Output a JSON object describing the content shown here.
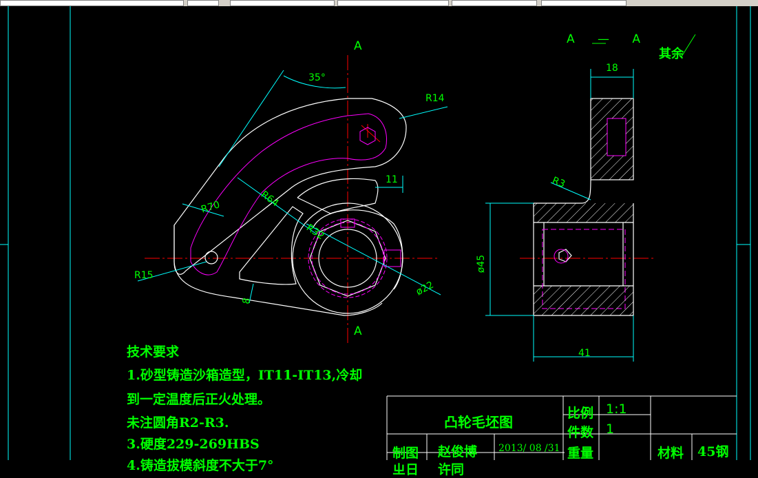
{
  "drawing": {
    "section_label_top": "A",
    "section_label_bottom": "A",
    "section_view_title": "A — A",
    "surface_finish_note": "其余",
    "dims": {
      "angle": "35°",
      "r14": "R14",
      "r64": "R64",
      "r70": "R70",
      "r32": "R32",
      "r15": "R15",
      "d11": "11",
      "d8": "8",
      "dia22": "ø22",
      "d18": "18",
      "r3": "R3",
      "dia45": "ø45",
      "d41": "41"
    }
  },
  "notes": {
    "heading": "技术要求",
    "lines": [
      "1.砂型铸造沙箱造型，IT11-IT13,冷却",
      "到一定温度后正火处理。",
      "未注圆角R2-R3.",
      "3.硬度229-269HBS",
      "4.铸造拔模斜度不大于7°"
    ]
  },
  "title_block": {
    "title": "凸轮毛坯图",
    "scale_label": "比例",
    "scale_value": "1:1",
    "count_label": "件数",
    "count_value": "1",
    "weight_label": "重量",
    "material_label": "材料",
    "material_value": "45钢",
    "drawn_label": "制图",
    "drawn_by": "赵俊博",
    "date": "2013/ 08 /31",
    "check_label": "ㄓ日",
    "check_by": "许同"
  },
  "colors": {
    "outline": "#ffffff",
    "dimension": "#00ffff",
    "text": "#00ff00",
    "center": "#ff0000",
    "hidden": "#ff00ff",
    "background": "#000000"
  }
}
